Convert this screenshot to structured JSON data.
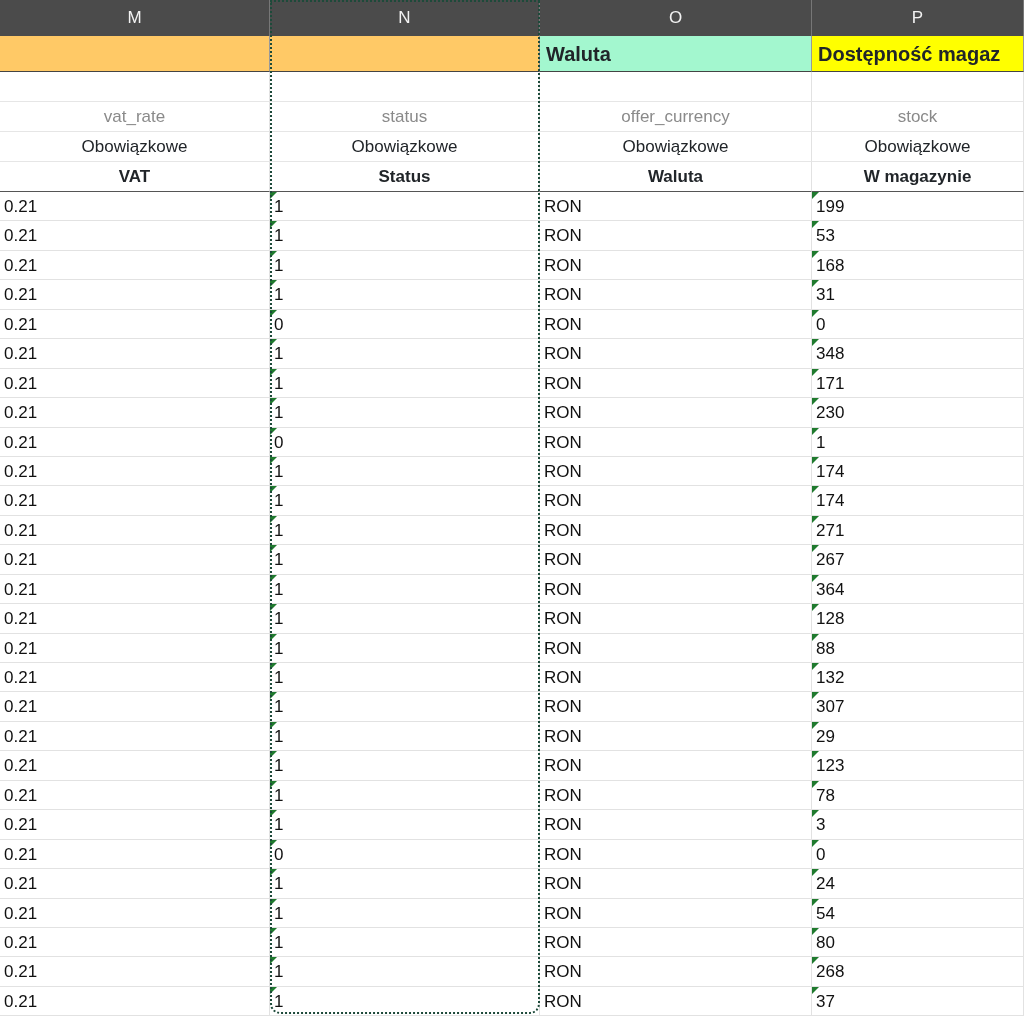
{
  "columns": [
    {
      "letter": "M",
      "color": "#ffc966",
      "field": "vat_rate",
      "requirement": "Obowiązkowe",
      "label": "VAT"
    },
    {
      "letter": "N",
      "color": "#ffc966",
      "field": "status",
      "requirement": "Obowiązkowe",
      "label": "Status",
      "corner_markers": true,
      "copy_marquee": true
    },
    {
      "letter": "O",
      "group": "Waluta",
      "color": "#a3f7cf",
      "field": "offer_currency",
      "requirement": "Obowiązkowe",
      "label": "Waluta"
    },
    {
      "letter": "P",
      "group": "Dostępność magaz",
      "color": "#ffff00",
      "field": "stock",
      "requirement": "Obowiązkowe",
      "label": "W magazynie",
      "corner_markers": true
    }
  ],
  "rows": [
    [
      "0.21",
      "1",
      "RON",
      "199"
    ],
    [
      "0.21",
      "1",
      "RON",
      "53"
    ],
    [
      "0.21",
      "1",
      "RON",
      "168"
    ],
    [
      "0.21",
      "1",
      "RON",
      "31"
    ],
    [
      "0.21",
      "0",
      "RON",
      "0"
    ],
    [
      "0.21",
      "1",
      "RON",
      "348"
    ],
    [
      "0.21",
      "1",
      "RON",
      "171"
    ],
    [
      "0.21",
      "1",
      "RON",
      "230"
    ],
    [
      "0.21",
      "0",
      "RON",
      "1"
    ],
    [
      "0.21",
      "1",
      "RON",
      "174"
    ],
    [
      "0.21",
      "1",
      "RON",
      "174"
    ],
    [
      "0.21",
      "1",
      "RON",
      "271"
    ],
    [
      "0.21",
      "1",
      "RON",
      "267"
    ],
    [
      "0.21",
      "1",
      "RON",
      "364"
    ],
    [
      "0.21",
      "1",
      "RON",
      "128"
    ],
    [
      "0.21",
      "1",
      "RON",
      "88"
    ],
    [
      "0.21",
      "1",
      "RON",
      "132"
    ],
    [
      "0.21",
      "1",
      "RON",
      "307"
    ],
    [
      "0.21",
      "1",
      "RON",
      "29"
    ],
    [
      "0.21",
      "1",
      "RON",
      "123"
    ],
    [
      "0.21",
      "1",
      "RON",
      "78"
    ],
    [
      "0.21",
      "1",
      "RON",
      "3"
    ],
    [
      "0.21",
      "0",
      "RON",
      "0"
    ],
    [
      "0.21",
      "1",
      "RON",
      "24"
    ],
    [
      "0.21",
      "1",
      "RON",
      "54"
    ],
    [
      "0.21",
      "1",
      "RON",
      "80"
    ],
    [
      "0.21",
      "1",
      "RON",
      "268"
    ],
    [
      "0.21",
      "1",
      "RON",
      "37"
    ]
  ]
}
